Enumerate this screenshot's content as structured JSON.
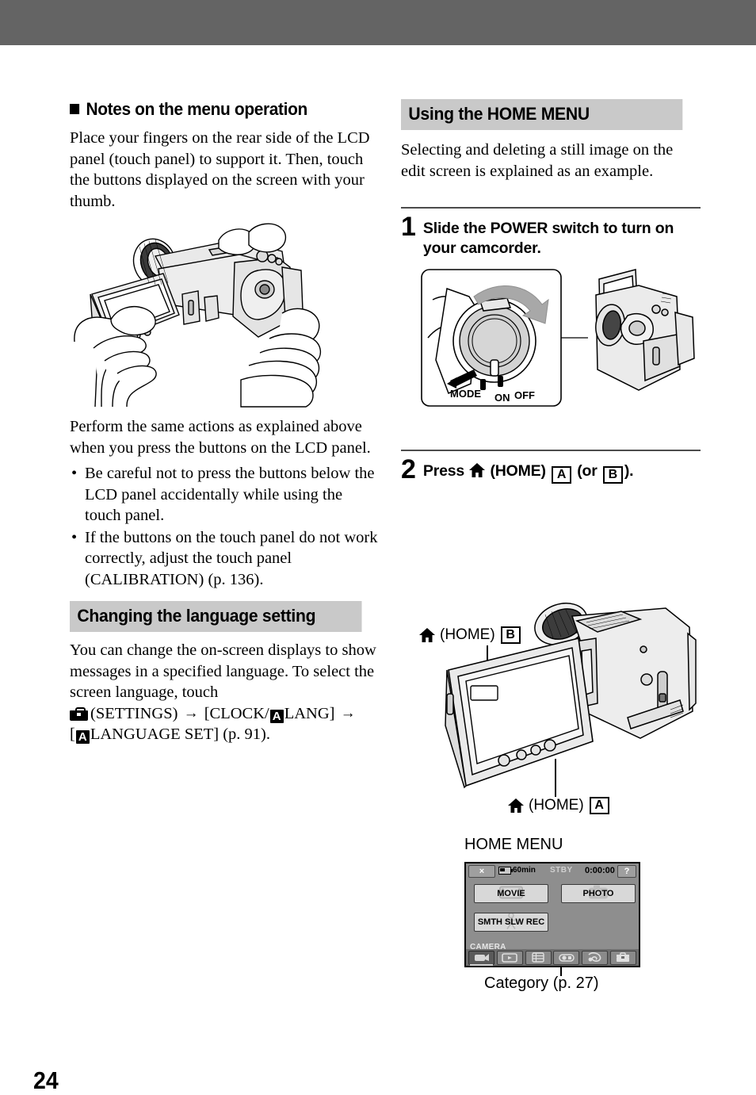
{
  "page": {
    "number": "24"
  },
  "left_column": {
    "notes_heading": "Notes on the menu operation",
    "notes_body": "Place your fingers on the rear side of the LCD panel (touch panel) to support it. Then, touch the buttons displayed on the screen with your thumb.",
    "figure_caption": "hands-holding-camcorder-illustration",
    "after_figure_body": "Perform the same actions as explained above when you press the buttons on the LCD panel.",
    "bullets": [
      "Be careful not to press the buttons below the LCD panel accidentally while using the touch panel.",
      "If the buttons on the touch panel do not work correctly, adjust the touch panel (CALIBRATION) (p. 136)."
    ],
    "language_heading": "Changing the language setting",
    "language_body_1": "You can change the on-screen displays to show messages in a specified language. To select the screen language, touch",
    "settings_label": "(SETTINGS)",
    "clock_lang_pre": "[CLOCK/",
    "icon_a": "A",
    "clock_lang_post": "LANG]",
    "language_set_open": "[",
    "language_set_post": "LANGUAGE SET] (p. 91).",
    "arrow": "→"
  },
  "right_column": {
    "home_menu_heading": "Using the HOME MENU",
    "home_menu_body": "Selecting and deleting a still image on the edit screen is explained as an example.",
    "steps": [
      {
        "number": "1",
        "text": "Slide the POWER switch to turn on your camcorder."
      },
      {
        "number": "2",
        "text_before": "Press",
        "home_word": "(HOME)",
        "badge_a": "A",
        "text_mid": "(or",
        "badge_b": "B",
        "text_end": ")."
      }
    ],
    "power_switch": {
      "mode": "MODE",
      "on": "ON",
      "off": "OFF"
    },
    "callouts": {
      "home_b": "(HOME)",
      "badge_b": "B",
      "home_a": "(HOME)",
      "badge_a": "A"
    },
    "home_menu_label": "HOME MENU",
    "category_caption": "Category (p. 27)"
  },
  "lcd_screen": {
    "close_label": "×",
    "battery_label": "60min",
    "status_label": "STBY",
    "timecode": "0:00:00",
    "help_label": "?",
    "buttons": [
      {
        "label": "MOVIE",
        "icon": "film-icon"
      },
      {
        "label": "PHOTO",
        "icon": "camera-icon"
      },
      {
        "label": "SMTH SLW REC",
        "icon": "person-icon"
      }
    ],
    "category_label": "CAMERA",
    "category_icons": [
      "camera-category-icon",
      "view-images-category-icon",
      "manage-media-category-icon",
      "edit-category-icon",
      "others-category-icon",
      "settings-category-icon"
    ]
  },
  "colors": {
    "top_band": "#646464",
    "heading_bar": "#c9c9c9",
    "rule": "#4c4c4c",
    "lcd_bg": "#8e8e8e"
  }
}
